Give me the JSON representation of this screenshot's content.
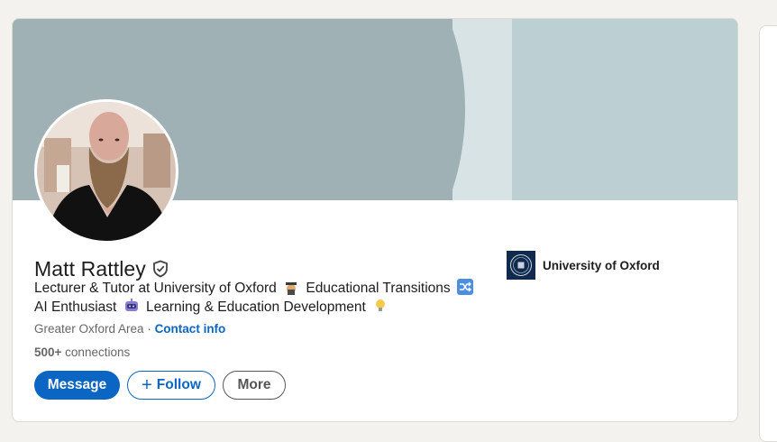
{
  "profile": {
    "name": "Matt Rattley",
    "headline_line1_a": "Lecturer & Tutor at University of Oxford",
    "headline_line1_b": "Educational Transitions",
    "headline_line2_a": "AI Enthusiast",
    "headline_line2_b": "Learning & Education Development",
    "location": "Greater Oxford Area",
    "separator": " · ",
    "contact_label": "Contact info",
    "connections_count": "500+",
    "connections_label": " connections"
  },
  "education": {
    "name": "University of Oxford"
  },
  "actions": {
    "message_label": "Message",
    "follow_label": "Follow",
    "more_label": "More"
  },
  "icons": {
    "verified": "verified-shield-icon",
    "graduation": "graduation-cap-emoji",
    "shuffle": "shuffle-emoji",
    "robot": "robot-emoji",
    "bulb": "light-bulb-emoji",
    "plus": "plus-icon"
  },
  "colors": {
    "accent": "#0a66c2",
    "banner": "#9fb1b5",
    "oxford_navy": "#0f2a4d"
  }
}
